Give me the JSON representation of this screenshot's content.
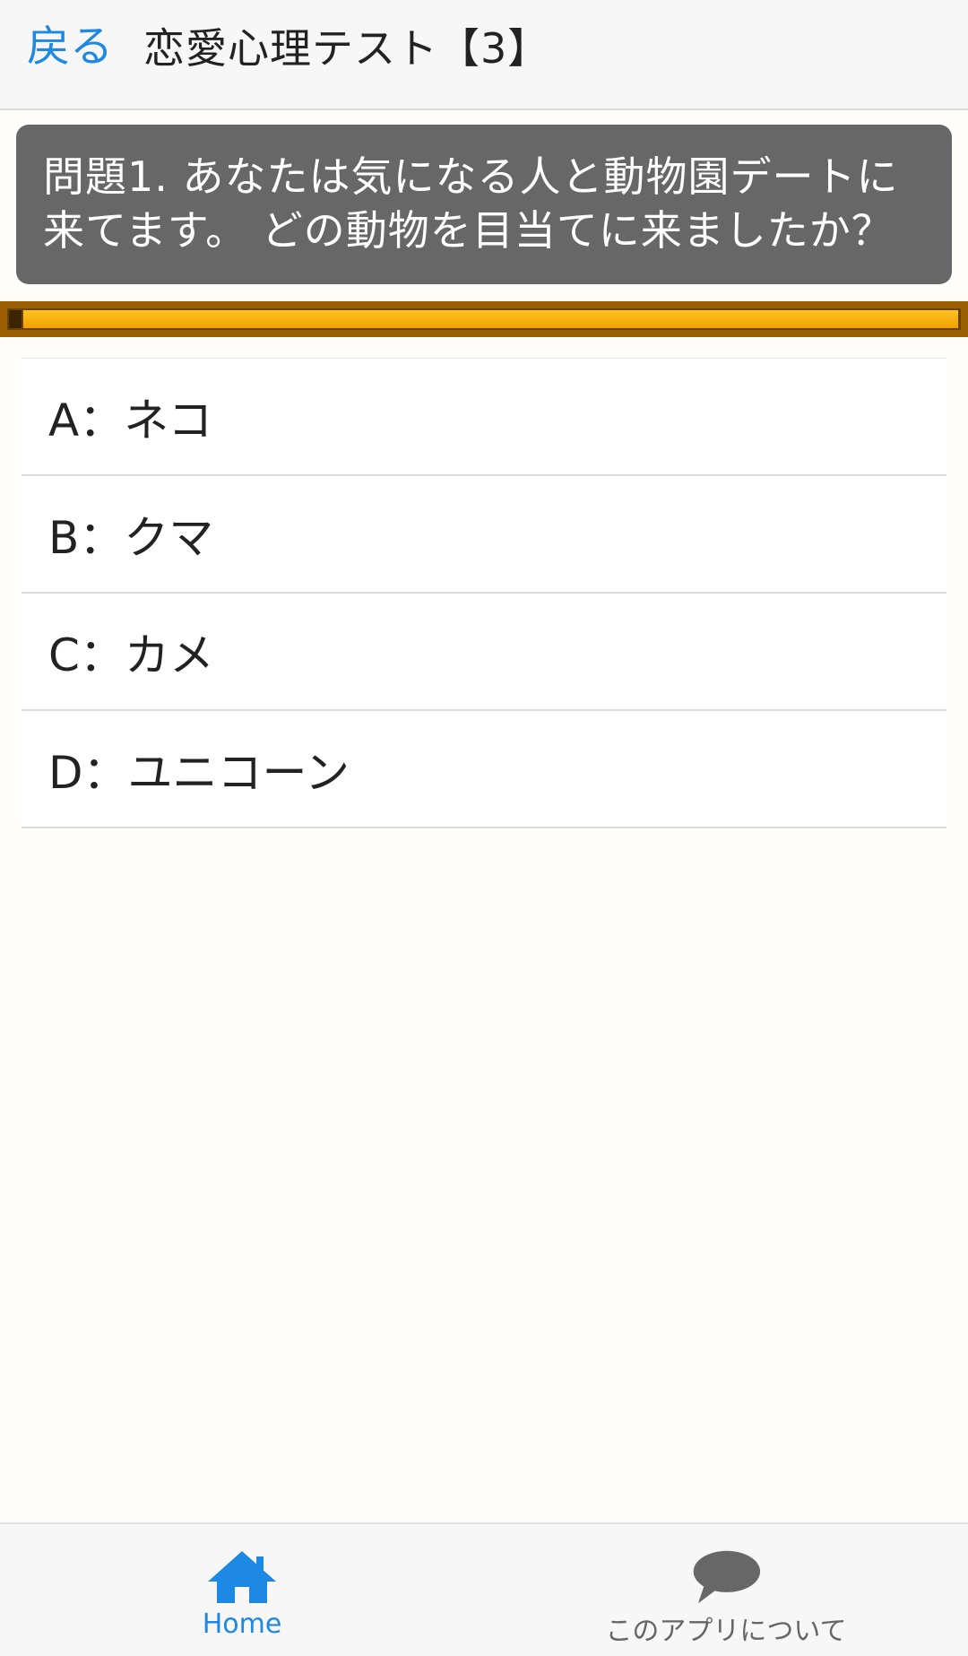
{
  "header": {
    "back_label": "戻る",
    "title": "恋愛心理テスト【3】"
  },
  "question": {
    "text": "問題1. あなたは気になる人と動物園デートに来てます。 どの動物を目当てに来ましたか？"
  },
  "progress": {
    "value": 0.98
  },
  "options": [
    {
      "label": "A：ネコ"
    },
    {
      "label": "B：クマ"
    },
    {
      "label": "C：カメ"
    },
    {
      "label": "D：ユニコーン"
    }
  ],
  "tabbar": {
    "home": {
      "label": "Home",
      "icon": "home-icon",
      "color": "#1e88e5"
    },
    "about": {
      "label": "このアプリについて",
      "icon": "speech-bubble-icon",
      "color": "#666666"
    }
  },
  "colors": {
    "accent": "#1e88e5",
    "question_bg": "#666766",
    "progress": "#f2a000"
  }
}
